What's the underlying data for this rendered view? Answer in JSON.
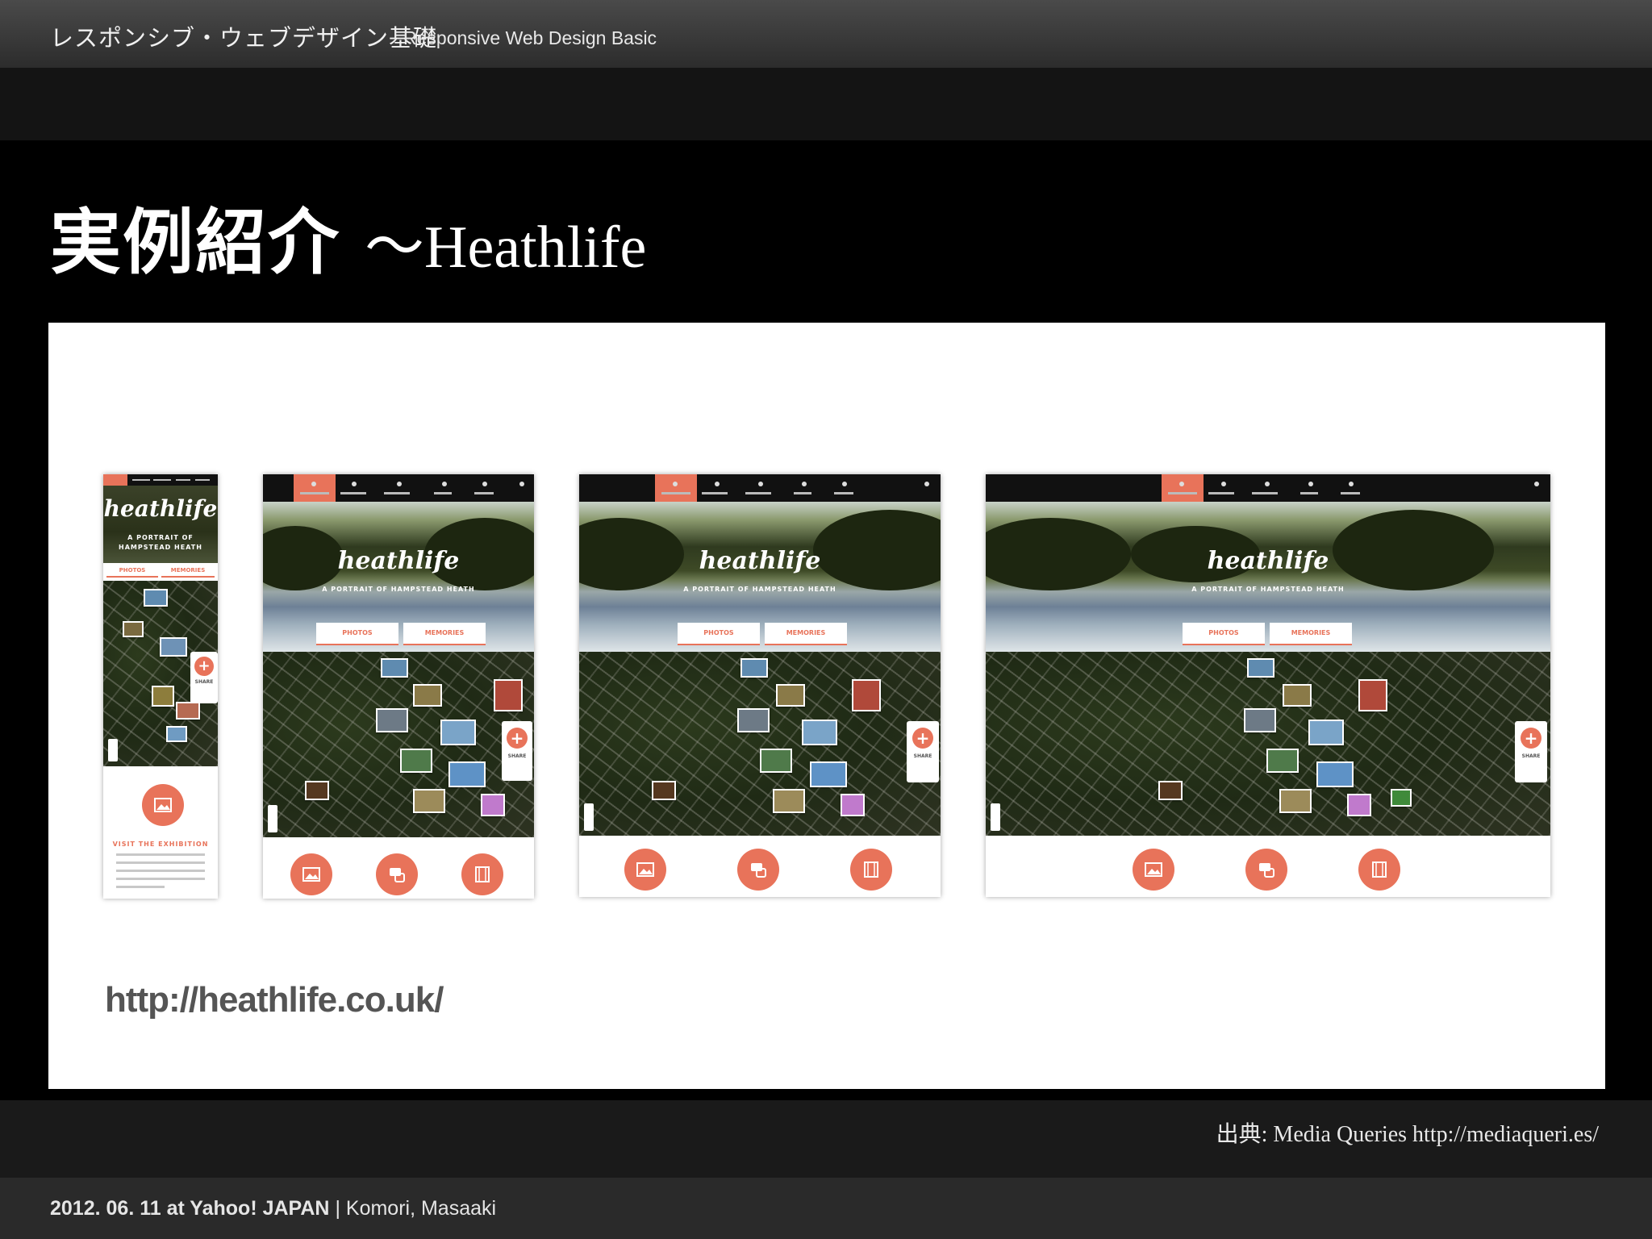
{
  "header": {
    "title_jp": "レスポンシブ・ウェブデザイン基礎",
    "title_en": "Responsive Web Design Basic"
  },
  "slide": {
    "title_jp": "実例紹介",
    "title_sep": "～",
    "title_en": "Heathlife"
  },
  "screenshots": {
    "logo": "heathlife",
    "tagline": "A PORTRAIT OF HAMPSTEAD HEATH",
    "tagline_mobile_1": "A PORTRAIT OF",
    "tagline_mobile_2": "HAMPSTEAD HEATH",
    "button_photos": "PHOTOS",
    "button_memories": "MEMORIES",
    "share_label": "SHARE",
    "exhibition_title": "VISIT THE EXHIBITION",
    "accent_color": "#e8735a",
    "icons": [
      "share-icon",
      "workshops-icon",
      "exhibition-icon",
      "about-icon",
      "donate-heart-icon",
      "sound-icon",
      "photo-icon",
      "memories-icon",
      "film-icon"
    ]
  },
  "url": "http://heathlife.co.uk/",
  "source": "出典: Media Queries http://mediaqueri.es/",
  "footer": {
    "date_event": "2012. 06. 11 at Yahoo! JAPAN",
    "separator": "|",
    "author": "Komori, Masaaki"
  }
}
